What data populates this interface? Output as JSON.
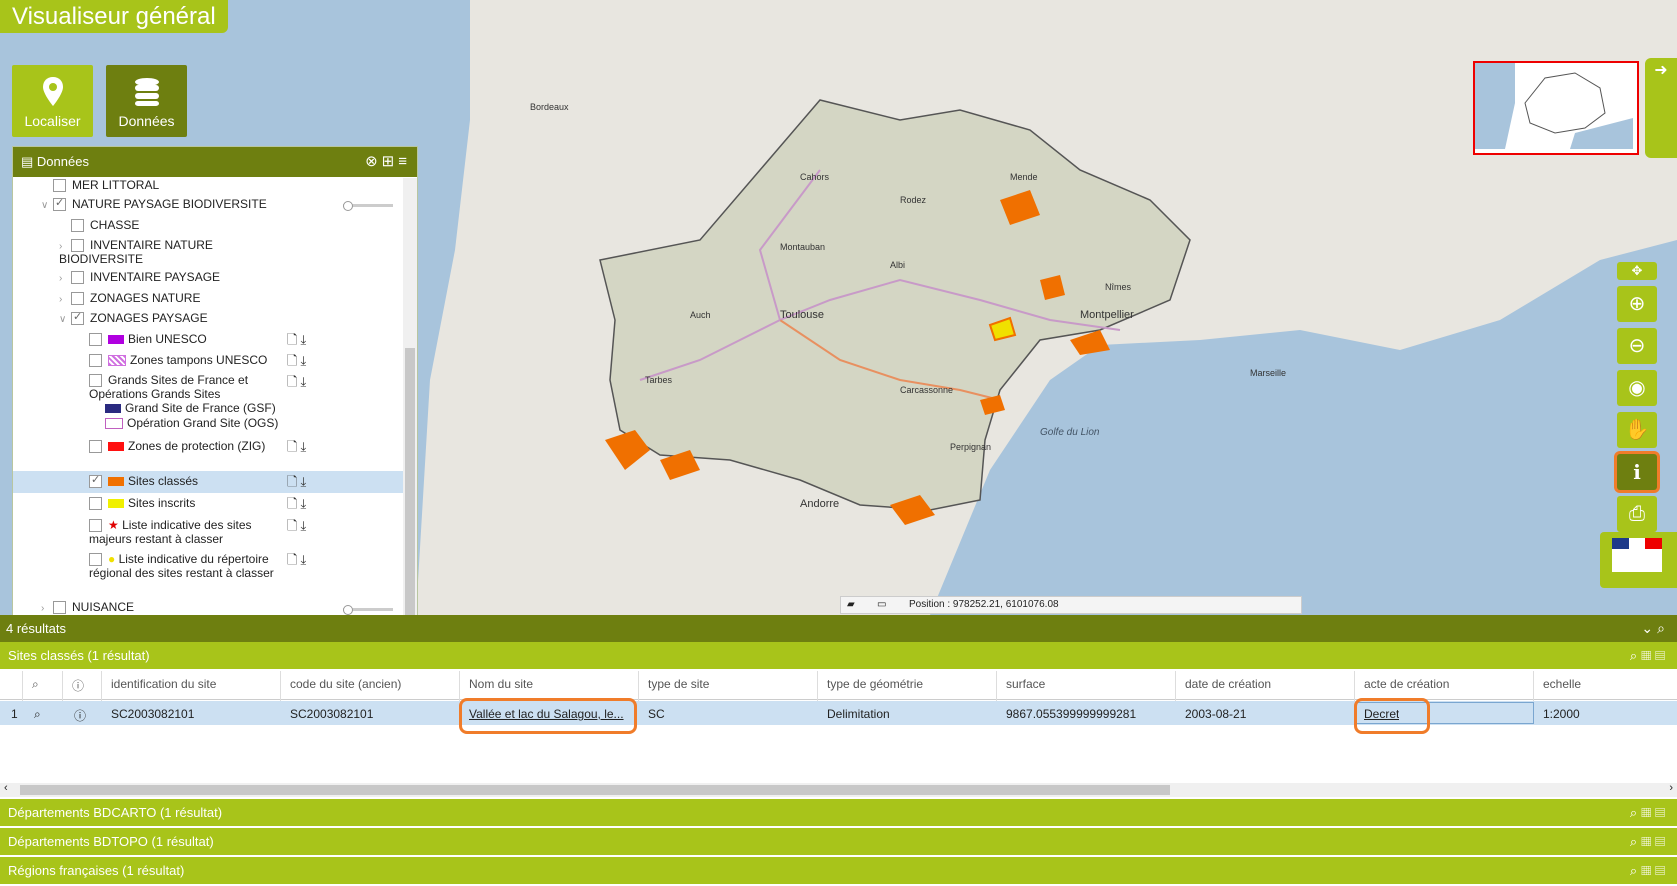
{
  "app_title": "Visualiseur général",
  "tiles": {
    "localiser": "Localiser",
    "donnees": "Données"
  },
  "panel": {
    "title": "Données",
    "tree": [
      {
        "label": "MER LITTORAL"
      },
      {
        "label": "NATURE PAYSAGE BIODIVERSITE"
      },
      {
        "label": "CHASSE"
      },
      {
        "label": "INVENTAIRE NATURE BIODIVERSITE"
      },
      {
        "label": "INVENTAIRE PAYSAGE"
      },
      {
        "label": "ZONAGES NATURE"
      },
      {
        "label": "ZONAGES PAYSAGE"
      },
      {
        "label": "Bien UNESCO",
        "color": "#b000e0"
      },
      {
        "label": "Zones tampons UNESCO",
        "color": "#d070e0"
      },
      {
        "label": "Grands Sites de France et Opérations Grands Sites"
      },
      {
        "label": "Grand Site de France (GSF)",
        "color": "#2a2a80"
      },
      {
        "label": "Opération Grand Site (OGS)",
        "color": "#c060c0"
      },
      {
        "label": "Zones de protection (ZIG)",
        "color": "#ff1010"
      },
      {
        "label": "Sites classés",
        "color": "#f07000"
      },
      {
        "label": "Sites inscrits",
        "color": "#f0f000"
      },
      {
        "label": "Liste indicative des sites majeurs restant à classer",
        "color": "#e00000"
      },
      {
        "label": "Liste indicative du répertoire régional des sites restant à classer",
        "color": "#f0e000"
      },
      {
        "label": "NUISANCE"
      }
    ]
  },
  "map": {
    "position_label": "Position : 978252.21, 6101076.08",
    "sea_label": "Golfe du Lion",
    "cities": [
      "Toulouse",
      "Montpellier",
      "Andorre",
      "Bordeaux",
      "Marseille",
      "Nîmes",
      "Perpignan",
      "Mende",
      "Rodez",
      "Albi",
      "Auch",
      "Tarbes",
      "Carcassonne",
      "Montauban",
      "Cahors"
    ]
  },
  "results": {
    "count_label": "4 résultats",
    "groups": [
      {
        "title": "Sites classés (1 résultat)"
      },
      {
        "title": "Départements BDCARTO (1 résultat)"
      },
      {
        "title": "Départements BDTOPO (1 résultat)"
      },
      {
        "title": "Régions françaises (1 résultat)"
      }
    ],
    "columns": [
      "identification du site",
      "code du site (ancien)",
      "Nom du site",
      "type de site",
      "type de géométrie",
      "surface",
      "date de création",
      "acte de création",
      "echelle"
    ],
    "row": {
      "index": "1",
      "identification": "SC2003082101",
      "code_ancien": "SC2003082101",
      "nom": "Vallée et lac du Salagou, le...",
      "type_site": "SC",
      "type_geometrie": "Delimitation",
      "surface": "9867.055399999999281",
      "date_creation": "2003-08-21",
      "acte_creation": "Decret",
      "echelle": "1:2000"
    }
  },
  "colors": {
    "accent_light": "#a8c41a",
    "accent_dark": "#6e7f10",
    "highlight": "#f07c2a"
  }
}
